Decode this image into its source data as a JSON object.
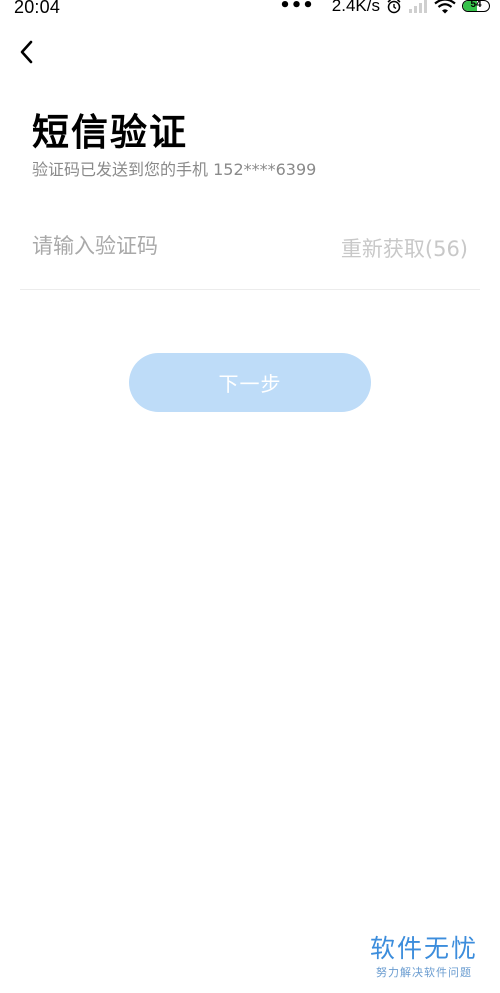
{
  "status_bar": {
    "time": "20:04",
    "dots": "•••",
    "net_speed": "2.4K/s",
    "battery_level": "54",
    "battery_fraction": 0.54
  },
  "header": {
    "title": "短信验证",
    "subtitle": "验证码已发送到您的手机 152****6399"
  },
  "form": {
    "code_placeholder": "请输入验证码",
    "resend_label": "重新获取(56)",
    "next_label": "下一步"
  },
  "watermark": {
    "main": "软件无忧",
    "sub": "努力解决软件问题"
  },
  "colors": {
    "button_bg": "#bedcf8",
    "watermark": "#3c8ddc",
    "battery": "#36c24a"
  }
}
